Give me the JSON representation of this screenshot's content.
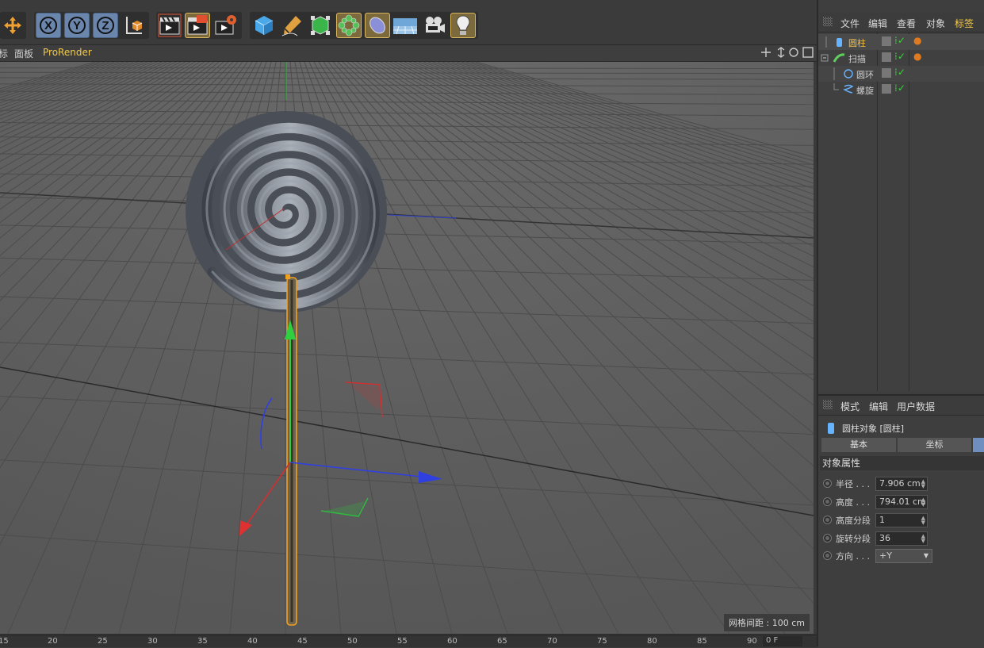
{
  "toolbar": {
    "buttons": [
      "move-icon",
      "x-axis",
      "y-axis",
      "z-axis",
      "coordinate-system",
      "render-view",
      "render-active",
      "render-settings",
      "cube",
      "pen",
      "subdivision",
      "array",
      "deformer",
      "floor",
      "camera",
      "light"
    ],
    "axis": {
      "x": "X",
      "y": "Y",
      "z": "Z"
    }
  },
  "viewport_menu": {
    "item0": "标",
    "item1": "面板",
    "item2": "ProRender"
  },
  "viewport": {
    "grid_spacing": "网格间距 : 100 cm"
  },
  "timeline": {
    "ticks": [
      "15",
      "20",
      "25",
      "30",
      "35",
      "40",
      "45",
      "50",
      "55",
      "60",
      "65",
      "70",
      "75",
      "80",
      "85",
      "90"
    ],
    "field": "0 F"
  },
  "object_manager": {
    "menu": [
      "文件",
      "编辑",
      "查看",
      "对象",
      "标签"
    ],
    "objects": [
      {
        "name": "圆柱",
        "color": "#f0c040"
      },
      {
        "name": "扫描",
        "color": "#d0d0d0"
      },
      {
        "name": "圆环",
        "color": "#d0d0d0"
      },
      {
        "name": "螺旋",
        "color": "#d0d0d0"
      }
    ]
  },
  "attributes": {
    "menu": [
      "模式",
      "编辑",
      "用户数据"
    ],
    "object_title": "圆柱对象 [圆柱]",
    "tabs": [
      "基本",
      "坐标"
    ],
    "section": "对象属性",
    "props": [
      {
        "label": "半径 . . .",
        "value": "7.906 cm"
      },
      {
        "label": "高度 . . .",
        "value": "794.01 cm"
      },
      {
        "label": "高度分段",
        "value": "1"
      },
      {
        "label": "旋转分段",
        "value": "36"
      },
      {
        "label": "方向 . . .",
        "value": "+Y"
      }
    ]
  }
}
